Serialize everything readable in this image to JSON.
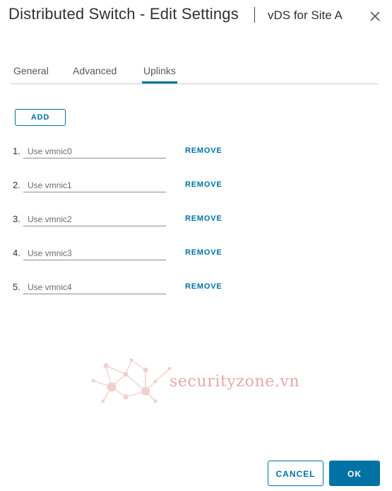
{
  "dialog": {
    "title": "Distributed Switch - Edit Settings",
    "subtitle": "vDS for Site A"
  },
  "tabs": [
    {
      "label": "General",
      "active": false
    },
    {
      "label": "Advanced",
      "active": false
    },
    {
      "label": "Uplinks",
      "active": true
    }
  ],
  "uplinks": {
    "add_label": "ADD",
    "remove_label": "REMOVE",
    "items": [
      {
        "number": "1.",
        "value": "Use vmnic0"
      },
      {
        "number": "2.",
        "value": "Use vmnic1"
      },
      {
        "number": "3.",
        "value": "Use vmnic2"
      },
      {
        "number": "4.",
        "value": "Use vmnic3"
      },
      {
        "number": "5.",
        "value": "Use vmnic4"
      }
    ]
  },
  "watermark": {
    "text": "securityzone.vn"
  },
  "footer": {
    "cancel_label": "CANCEL",
    "ok_label": "OK"
  },
  "colors": {
    "accent": "#0072a3",
    "watermark": "#e6a9aa"
  },
  "icons": {
    "close": "close-icon"
  }
}
